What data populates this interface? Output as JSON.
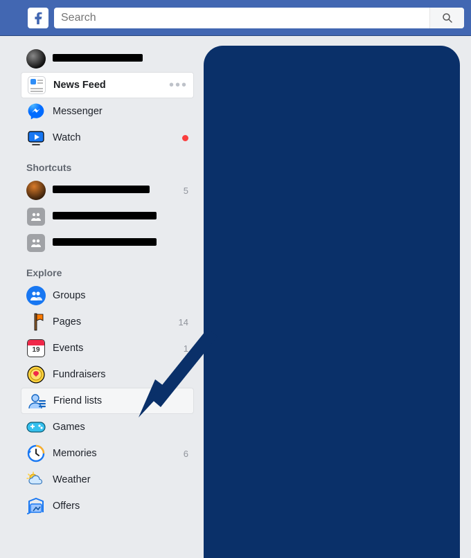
{
  "colors": {
    "brand": "#4267b2",
    "topbar_border": "#29487d",
    "overlay": "#0a3069",
    "text": "#1d2129",
    "muted": "#616770",
    "count": "#90949c",
    "notif": "#fa3e3e"
  },
  "search": {
    "placeholder": "Search",
    "value": ""
  },
  "profile": {
    "name": "████████████"
  },
  "primary_nav": [
    {
      "key": "news-feed",
      "label": "News Feed",
      "icon": "feed-icon",
      "selected": true,
      "has_menu": true
    },
    {
      "key": "messenger",
      "label": "Messenger",
      "icon": "messenger-icon"
    },
    {
      "key": "watch",
      "label": "Watch",
      "icon": "watch-icon",
      "has_notification": true
    }
  ],
  "sections": {
    "shortcuts": {
      "header": "Shortcuts"
    },
    "explore": {
      "header": "Explore"
    }
  },
  "shortcuts": [
    {
      "key": "sc1",
      "label": "████████████",
      "count": "5",
      "icon": "group-avatar-dark"
    },
    {
      "key": "sc2",
      "label": "████████████",
      "icon": "group-avatar-grey"
    },
    {
      "key": "sc3",
      "label": "████████████",
      "icon": "group-avatar-grey"
    }
  ],
  "explore": [
    {
      "key": "groups",
      "label": "Groups",
      "icon": "groups-icon"
    },
    {
      "key": "pages",
      "label": "Pages",
      "icon": "pages-icon",
      "count": "14"
    },
    {
      "key": "events",
      "label": "Events",
      "icon": "events-icon",
      "count": "1",
      "calendar_day": "19"
    },
    {
      "key": "fundraisers",
      "label": "Fundraisers",
      "icon": "fundraisers-icon"
    },
    {
      "key": "friend-lists",
      "label": "Friend lists",
      "icon": "friend-lists-icon",
      "highlighted": true
    },
    {
      "key": "games",
      "label": "Games",
      "icon": "games-icon"
    },
    {
      "key": "memories",
      "label": "Memories",
      "icon": "memories-icon",
      "count": "6"
    },
    {
      "key": "weather",
      "label": "Weather",
      "icon": "weather-icon"
    },
    {
      "key": "offers",
      "label": "Offers",
      "icon": "offers-icon"
    }
  ],
  "annotation": {
    "target": "friend-lists"
  }
}
